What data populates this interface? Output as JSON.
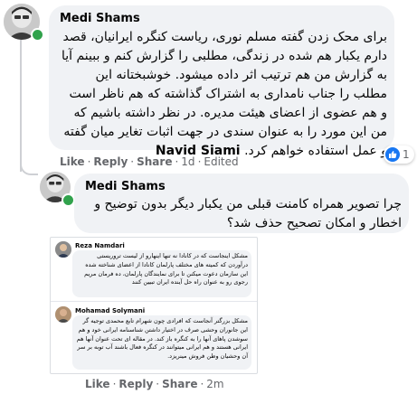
{
  "comments": [
    {
      "author": "Medi Shams",
      "text_before": "برای محک زدن گفته مسلم نوری، ریاست کنگره ایرانیان، قصد دارم یکبار هم شده در زندگی، مطلبی را گزارش کنم و ببینم آیا به گزارش من هم ترتیب اثر داده میشود. خوشبختانه این مطلب را جناب نامداری به اشتراک گذاشته که هم ناظر است و هم عضوی از اعضای هیئت مدیره. در نظر داشته باشیم که من این مورد را به عنوان سندی در جهت اثبات تغایر میان گفته و عمل استفاده خواهم کرد.",
      "mention": "Navid Siami",
      "actions": {
        "like": "Like",
        "reply": "Reply",
        "share": "Share",
        "time": "1d",
        "edited": "Edited"
      },
      "reaction_count": "1"
    },
    {
      "author": "Medi Shams",
      "text": "چرا تصویر همراه کامنت قبلی من یکبار دیگر بدون توضیح و اخطار و امکان تصحیح حذف شد؟",
      "actions": {
        "like": "Like",
        "reply": "Reply",
        "share": "Share",
        "time": "2m"
      }
    }
  ],
  "attachment": {
    "comments": [
      {
        "author": "Reza Namdari",
        "text": "مشکل اینجاست که در کانادا نه تنها اینهارو از لیست تروریستی درآوردن که کمیته های مختلف پارلمان کانادا از اعضای شناخته شده این سازمان دعوت میکنن تا برای نمایندگان پارلمان، ده فرمان مریم رجوی رو به عنوان راه حل آینده ایران تبیین کنند"
      },
      {
        "author": "Mohamad Solymani",
        "text": "مشکل بزرگتر آنجاست که افرادی چون شهرام تابع محمدی توجیه گر این جانوران وحشی صرف در اختیار داشتن شناسنامه ایرانی خود و هم سوشدن پاهای آنها را به کنگره باز کند. در مقاله ای تحت عنوان آنها هم ایرانی هستند و هم ایرانی میتوانند در کنگره فعال باشند آب توبه بر سر آن وحشیان وطن فروش مینریزد."
      }
    ]
  }
}
